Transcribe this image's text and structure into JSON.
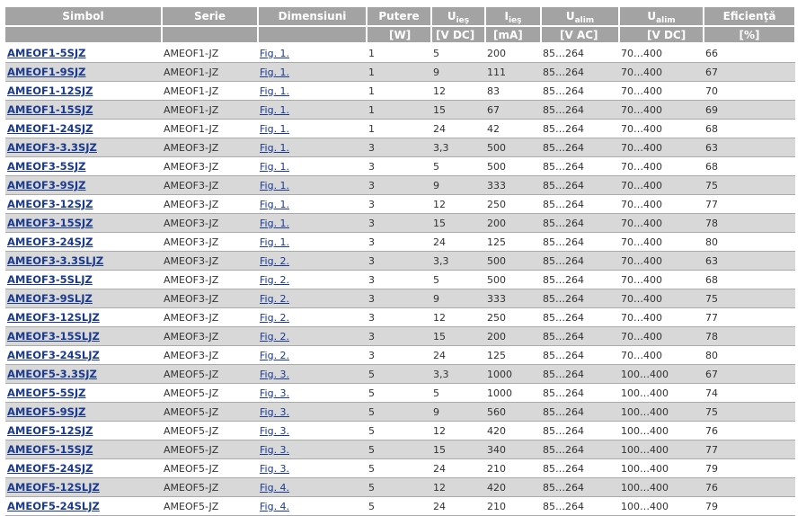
{
  "headers": {
    "simbol": "Simbol",
    "serie": "Serie",
    "dimensiuni": "Dimensiuni",
    "putere": "Putere",
    "uies": "U",
    "uies_sub": "ieş",
    "iies": "I",
    "iies_sub": "ieş",
    "ualim_ac": "U",
    "ualim_ac_sub": "alim",
    "ualim_dc": "U",
    "ualim_dc_sub": "alim",
    "eficienta": "Eficienţă"
  },
  "units": {
    "putere": "[W]",
    "uies": "[V DC]",
    "iies": "[mA]",
    "ualim_ac": "[V AC]",
    "ualim_dc": "[V DC]",
    "eficienta": "[%]"
  },
  "rows": [
    {
      "simbol": "AMEOF1-5SJZ",
      "serie": "AMEOF1-JZ",
      "dim": "Fig. 1.",
      "putere": "1",
      "uies": "5",
      "iies": "200",
      "uac": "85…264",
      "udc": "70…400",
      "ef": "66"
    },
    {
      "simbol": "AMEOF1-9SJZ",
      "serie": "AMEOF1-JZ",
      "dim": "Fig. 1.",
      "putere": "1",
      "uies": "9",
      "iies": "111",
      "uac": "85…264",
      "udc": "70…400",
      "ef": "67"
    },
    {
      "simbol": "AMEOF1-12SJZ",
      "serie": "AMEOF1-JZ",
      "dim": "Fig. 1.",
      "putere": "1",
      "uies": "12",
      "iies": "83",
      "uac": "85…264",
      "udc": "70…400",
      "ef": "70"
    },
    {
      "simbol": "AMEOF1-15SJZ",
      "serie": "AMEOF1-JZ",
      "dim": "Fig. 1.",
      "putere": "1",
      "uies": "15",
      "iies": "67",
      "uac": "85…264",
      "udc": "70…400",
      "ef": "69"
    },
    {
      "simbol": "AMEOF1-24SJZ",
      "serie": "AMEOF1-JZ",
      "dim": "Fig. 1.",
      "putere": "1",
      "uies": "24",
      "iies": "42",
      "uac": "85…264",
      "udc": "70…400",
      "ef": "68"
    },
    {
      "simbol": "AMEOF3-3.3SJZ",
      "serie": "AMEOF3-JZ",
      "dim": "Fig. 1.",
      "putere": "3",
      "uies": "3,3",
      "iies": "500",
      "uac": "85…264",
      "udc": "70…400",
      "ef": "63"
    },
    {
      "simbol": "AMEOF3-5SJZ",
      "serie": "AMEOF3-JZ",
      "dim": "Fig. 1.",
      "putere": "3",
      "uies": "5",
      "iies": "500",
      "uac": "85…264",
      "udc": "70…400",
      "ef": "68"
    },
    {
      "simbol": "AMEOF3-9SJZ",
      "serie": "AMEOF3-JZ",
      "dim": "Fig. 1.",
      "putere": "3",
      "uies": "9",
      "iies": "333",
      "uac": "85…264",
      "udc": "70…400",
      "ef": "75"
    },
    {
      "simbol": "AMEOF3-12SJZ",
      "serie": "AMEOF3-JZ",
      "dim": "Fig. 1.",
      "putere": "3",
      "uies": "12",
      "iies": "250",
      "uac": "85…264",
      "udc": "70…400",
      "ef": "77"
    },
    {
      "simbol": "AMEOF3-15SJZ",
      "serie": "AMEOF3-JZ",
      "dim": "Fig. 1.",
      "putere": "3",
      "uies": "15",
      "iies": "200",
      "uac": "85…264",
      "udc": "70…400",
      "ef": "78"
    },
    {
      "simbol": "AMEOF3-24SJZ",
      "serie": "AMEOF3-JZ",
      "dim": "Fig. 1.",
      "putere": "3",
      "uies": "24",
      "iies": "125",
      "uac": "85…264",
      "udc": "70…400",
      "ef": "80"
    },
    {
      "simbol": "AMEOF3-3.3SLJZ",
      "serie": "AMEOF3-JZ",
      "dim": "Fig. 2.",
      "putere": "3",
      "uies": "3,3",
      "iies": "500",
      "uac": "85…264",
      "udc": "70…400",
      "ef": "63"
    },
    {
      "simbol": "AMEOF3-5SLJZ",
      "serie": "AMEOF3-JZ",
      "dim": "Fig. 2.",
      "putere": "3",
      "uies": "5",
      "iies": "500",
      "uac": "85…264",
      "udc": "70…400",
      "ef": "68"
    },
    {
      "simbol": "AMEOF3-9SLJZ",
      "serie": "AMEOF3-JZ",
      "dim": "Fig. 2.",
      "putere": "3",
      "uies": "9",
      "iies": "333",
      "uac": "85…264",
      "udc": "70…400",
      "ef": "75"
    },
    {
      "simbol": "AMEOF3-12SLJZ",
      "serie": "AMEOF3-JZ",
      "dim": "Fig. 2.",
      "putere": "3",
      "uies": "12",
      "iies": "250",
      "uac": "85…264",
      "udc": "70…400",
      "ef": "77"
    },
    {
      "simbol": "AMEOF3-15SLJZ",
      "serie": "AMEOF3-JZ",
      "dim": "Fig. 2.",
      "putere": "3",
      "uies": "15",
      "iies": "200",
      "uac": "85…264",
      "udc": "70…400",
      "ef": "78"
    },
    {
      "simbol": "AMEOF3-24SLJZ",
      "serie": "AMEOF3-JZ",
      "dim": "Fig. 2.",
      "putere": "3",
      "uies": "24",
      "iies": "125",
      "uac": "85…264",
      "udc": "70…400",
      "ef": "80"
    },
    {
      "simbol": "AMEOF5-3.3SJZ",
      "serie": "AMEOF5-JZ",
      "dim": "Fig. 3.",
      "putere": "5",
      "uies": "3,3",
      "iies": "1000",
      "uac": "85…264",
      "udc": "100…400",
      "ef": "67"
    },
    {
      "simbol": "AMEOF5-5SJZ",
      "serie": "AMEOF5-JZ",
      "dim": "Fig. 3.",
      "putere": "5",
      "uies": "5",
      "iies": "1000",
      "uac": "85…264",
      "udc": "100…400",
      "ef": "74"
    },
    {
      "simbol": "AMEOF5-9SJZ",
      "serie": "AMEOF5-JZ",
      "dim": "Fig. 3.",
      "putere": "5",
      "uies": "9",
      "iies": "560",
      "uac": "85…264",
      "udc": "100…400",
      "ef": "75"
    },
    {
      "simbol": "AMEOF5-12SJZ",
      "serie": "AMEOF5-JZ",
      "dim": "Fig. 3.",
      "putere": "5",
      "uies": "12",
      "iies": "420",
      "uac": "85…264",
      "udc": "100…400",
      "ef": "76"
    },
    {
      "simbol": "AMEOF5-15SJZ",
      "serie": "AMEOF5-JZ",
      "dim": "Fig. 3.",
      "putere": "5",
      "uies": "15",
      "iies": "340",
      "uac": "85…264",
      "udc": "100…400",
      "ef": "77"
    },
    {
      "simbol": "AMEOF5-24SJZ",
      "serie": "AMEOF5-JZ",
      "dim": "Fig. 3.",
      "putere": "5",
      "uies": "24",
      "iies": "210",
      "uac": "85…264",
      "udc": "100…400",
      "ef": "79"
    },
    {
      "simbol": "AMEOF5-12SLJZ",
      "serie": "AMEOF5-JZ",
      "dim": "Fig. 4.",
      "putere": "5",
      "uies": "12",
      "iies": "420",
      "uac": "85…264",
      "udc": "100…400",
      "ef": "76"
    },
    {
      "simbol": "AMEOF5-24SLJZ",
      "serie": "AMEOF5-JZ",
      "dim": "Fig. 4.",
      "putere": "5",
      "uies": "24",
      "iies": "210",
      "uac": "85…264",
      "udc": "100…400",
      "ef": "79"
    }
  ]
}
